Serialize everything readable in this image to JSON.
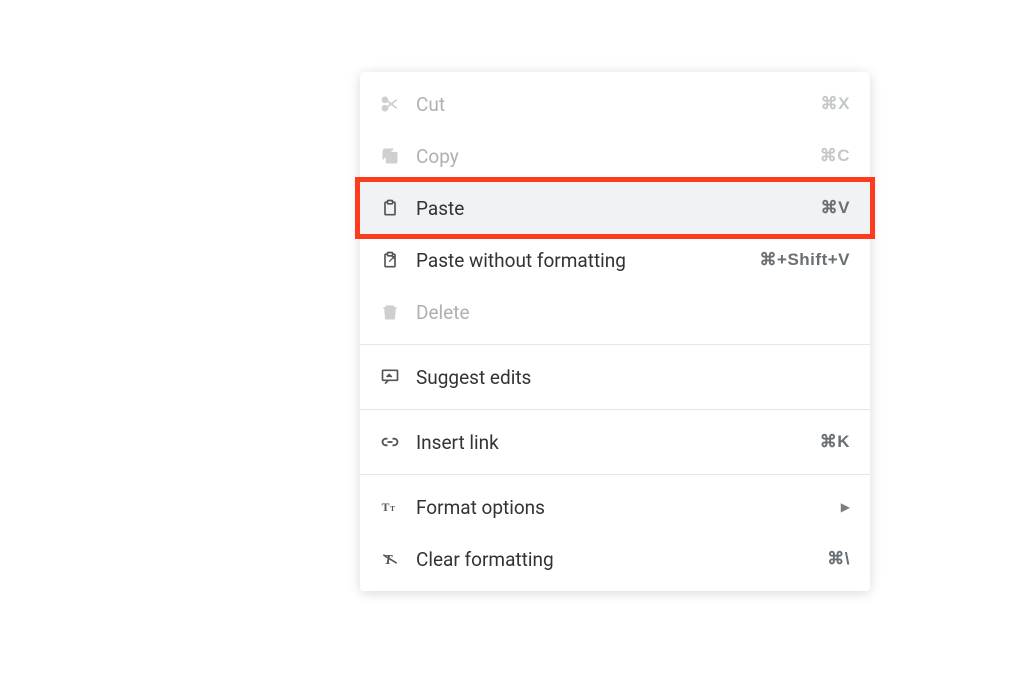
{
  "menu": {
    "items": [
      {
        "label": "Cut",
        "shortcut": "⌘X",
        "disabled": true,
        "icon": "scissors-icon"
      },
      {
        "label": "Copy",
        "shortcut": "⌘C",
        "disabled": true,
        "icon": "copy-icon"
      },
      {
        "label": "Paste",
        "shortcut": "⌘V",
        "disabled": false,
        "highlighted": true,
        "icon": "paste-icon"
      },
      {
        "label": "Paste without formatting",
        "shortcut": "⌘+Shift+V",
        "disabled": false,
        "icon": "paste-plain-icon"
      },
      {
        "label": "Delete",
        "shortcut": "",
        "disabled": true,
        "icon": "delete-icon"
      },
      {
        "divider": true
      },
      {
        "label": "Suggest edits",
        "shortcut": "",
        "disabled": false,
        "icon": "suggest-icon"
      },
      {
        "divider": true
      },
      {
        "label": "Insert link",
        "shortcut": "⌘K",
        "disabled": false,
        "icon": "link-icon"
      },
      {
        "divider": true
      },
      {
        "label": "Format options",
        "shortcut": "",
        "submenu": true,
        "disabled": false,
        "icon": "format-icon"
      },
      {
        "label": "Clear formatting",
        "shortcut": "⌘\\",
        "disabled": false,
        "icon": "clear-format-icon"
      }
    ]
  }
}
